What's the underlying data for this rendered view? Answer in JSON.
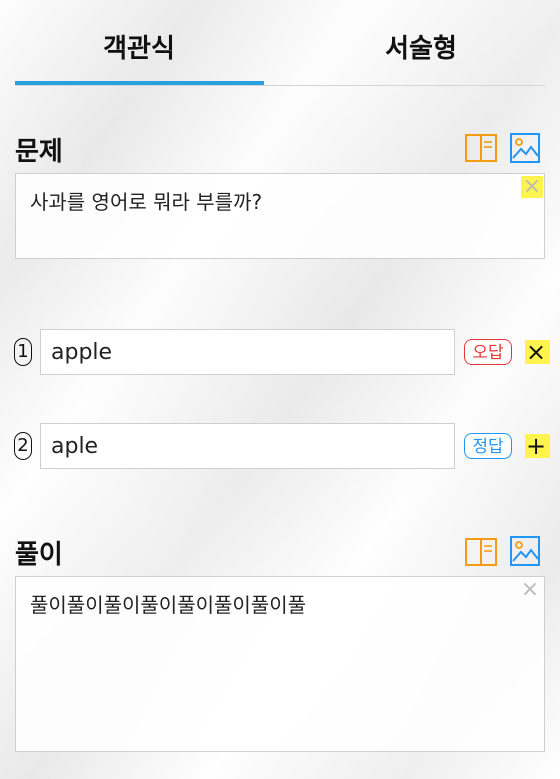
{
  "tabs": [
    {
      "label": "객관식",
      "active": true
    },
    {
      "label": "서술형",
      "active": false
    }
  ],
  "question": {
    "title": "문제",
    "text": "사과를 영어로 뭐라 부를까?"
  },
  "options": [
    {
      "number": "1",
      "value": "apple",
      "status": "오답",
      "action": "×"
    },
    {
      "number": "2",
      "value": "aple",
      "status": "정답",
      "action": "+"
    }
  ],
  "solution": {
    "title": "풀이",
    "text": "풀이풀이풀이풀이풀이풀이풀이풀"
  },
  "colors": {
    "accent": "#2aa0e2",
    "wrong": "#e53935",
    "right": "#2196f3",
    "icon_orange": "#f39c12",
    "icon_blue": "#2196f3",
    "highlight": "#fff34d"
  },
  "icons": [
    "book-icon",
    "image-icon",
    "close-icon",
    "plus-icon"
  ]
}
